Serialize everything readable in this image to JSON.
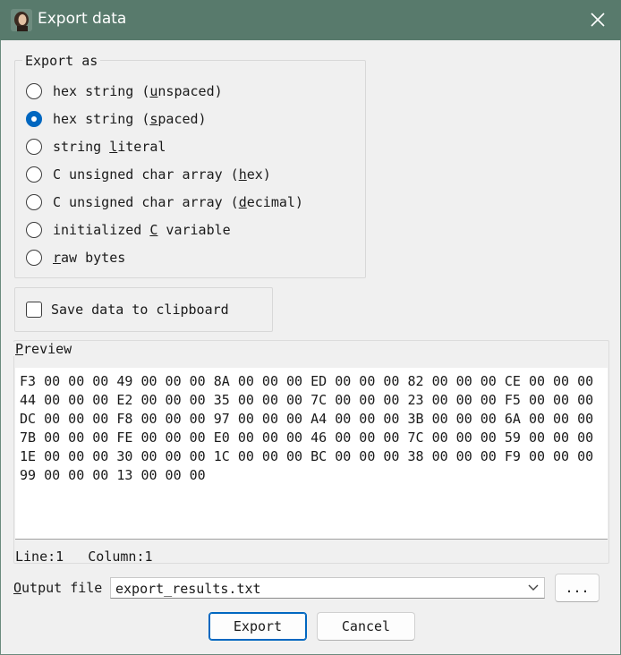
{
  "window": {
    "title": "Export data"
  },
  "export_as": {
    "legend": "Export as",
    "options": [
      {
        "pre": "hex string (",
        "key": "u",
        "post": "nspaced)",
        "checked": false
      },
      {
        "pre": "hex string (",
        "key": "s",
        "post": "paced)",
        "checked": true
      },
      {
        "pre": "string ",
        "key": "l",
        "post": "iteral",
        "checked": false
      },
      {
        "pre": "C unsigned char array (",
        "key": "h",
        "post": "ex)",
        "checked": false
      },
      {
        "pre": "C unsigned char array (",
        "key": "d",
        "post": "ecimal)",
        "checked": false
      },
      {
        "pre": "initialized ",
        "key": "C",
        "post": " variable",
        "checked": false
      },
      {
        "pre": "",
        "key": "r",
        "post": "aw bytes",
        "checked": false
      }
    ]
  },
  "clipboard": {
    "label": "Save data to clipboard",
    "checked": false
  },
  "preview": {
    "legend_key": "P",
    "legend_rest": "review",
    "lines": [
      "F3 00 00 00 49 00 00 00 8A 00 00 00 ED 00 00 00 82 00 00 00 CE 00 00 00",
      "44 00 00 00 E2 00 00 00 35 00 00 00 7C 00 00 00 23 00 00 00 F5 00 00 00",
      "DC 00 00 00 F8 00 00 00 97 00 00 00 A4 00 00 00 3B 00 00 00 6A 00 00 00",
      "7B 00 00 00 FE 00 00 00 E0 00 00 00 46 00 00 00 7C 00 00 00 59 00 00 00",
      "1E 00 00 00 30 00 00 00 1C 00 00 00 BC 00 00 00 38 00 00 00 F9 00 00 00",
      "99 00 00 00 13 00 00 00"
    ]
  },
  "status": {
    "line": "Line:1",
    "column": "Column:1"
  },
  "output": {
    "label_key": "O",
    "label_rest": "utput file",
    "value": "export_results.txt",
    "browse_label": "..."
  },
  "buttons": {
    "export": "Export",
    "cancel": "Cancel"
  },
  "colors": {
    "titlebar": "#587a6c",
    "accent": "#0067c0"
  }
}
